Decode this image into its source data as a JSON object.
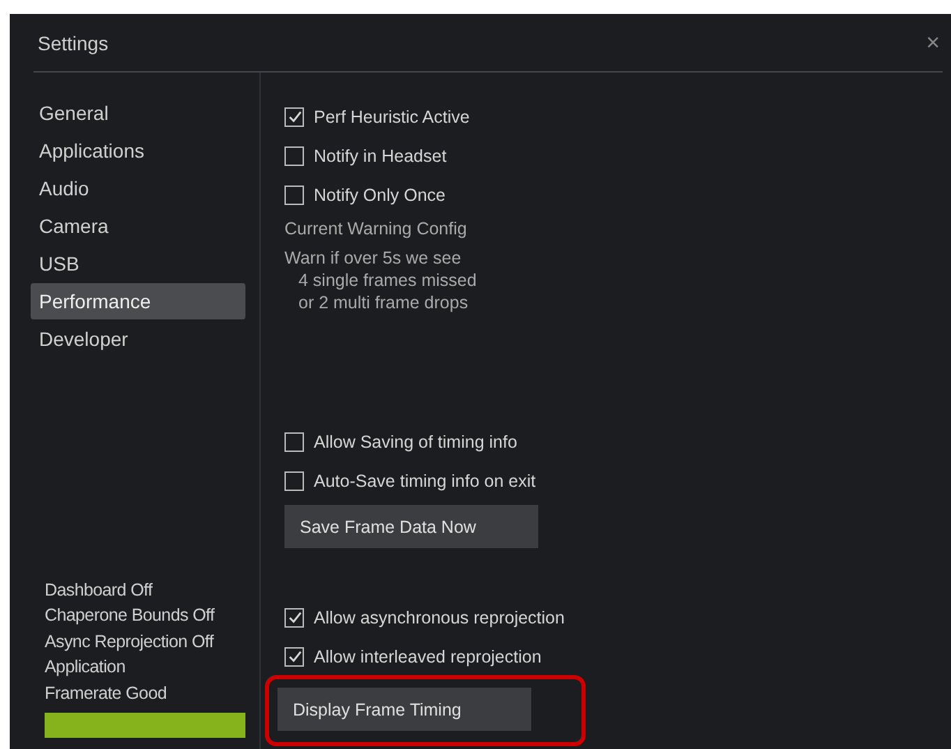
{
  "window": {
    "title": "Settings",
    "close": "×"
  },
  "sidebar": {
    "items": [
      {
        "label": "General",
        "selected": false
      },
      {
        "label": "Applications",
        "selected": false
      },
      {
        "label": "Audio",
        "selected": false
      },
      {
        "label": "Camera",
        "selected": false
      },
      {
        "label": "USB",
        "selected": false
      },
      {
        "label": "Performance",
        "selected": true
      },
      {
        "label": "Developer",
        "selected": false
      }
    ],
    "status": [
      "Dashboard Off",
      "Chaperone Bounds Off",
      "Async Reprojection Off",
      "Application",
      "Framerate Good"
    ],
    "status_bar": {
      "color": "#86b31c"
    }
  },
  "content": {
    "top_checks": [
      {
        "label": "Perf Heuristic Active",
        "checked": true
      },
      {
        "label": "Notify in Headset",
        "checked": false
      },
      {
        "label": "Notify Only Once",
        "checked": false
      }
    ],
    "warning_heading": "Current Warning Config",
    "warning_lines": [
      "Warn if over 5s we see",
      "4 single frames missed",
      "or 2 multi frame drops"
    ],
    "save_checks": [
      {
        "label": "Allow Saving of timing info",
        "checked": false
      },
      {
        "label": "Auto-Save timing info on exit",
        "checked": false
      }
    ],
    "save_button": "Save Frame Data Now",
    "reprojection_checks": [
      {
        "label": "Allow asynchronous reprojection",
        "checked": true
      },
      {
        "label": "Allow interleaved reprojection",
        "checked": true
      }
    ],
    "timing_button": {
      "label": "Display Frame Timing",
      "highlighted": true
    }
  }
}
